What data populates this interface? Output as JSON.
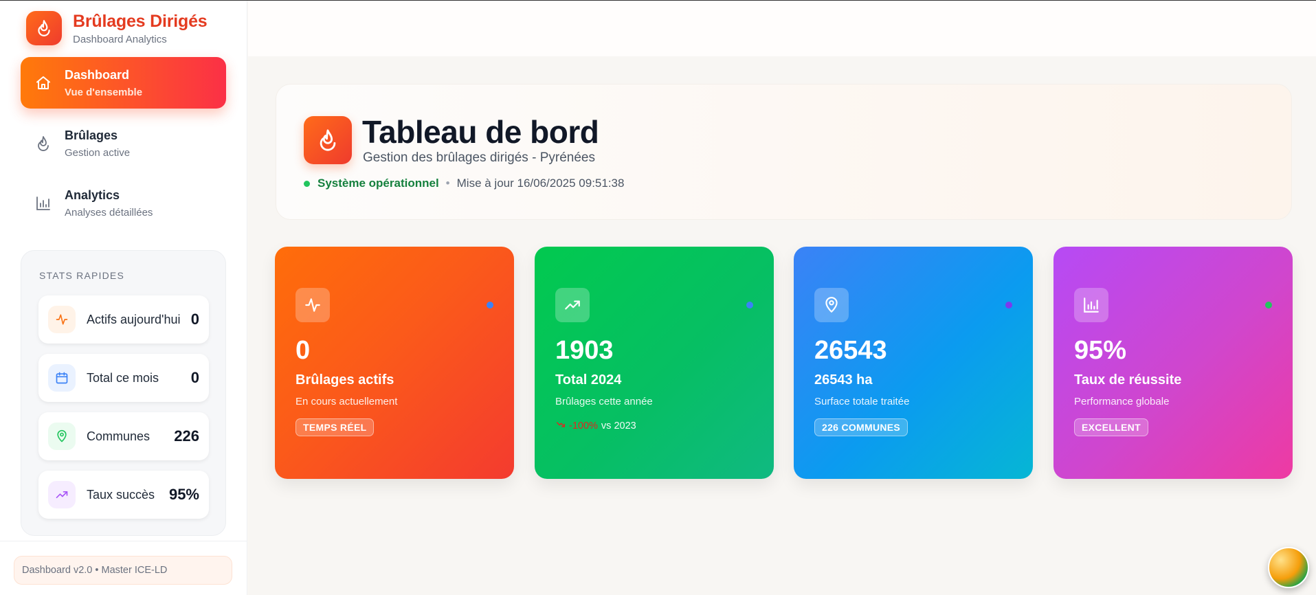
{
  "brand": {
    "title": "Brûlages Dirigés",
    "subtitle": "Dashboard Analytics",
    "logo_icon": "flame-icon"
  },
  "nav": [
    {
      "title": "Dashboard",
      "subtitle": "Vue d'ensemble",
      "icon": "home-icon",
      "active": true
    },
    {
      "title": "Brûlages",
      "subtitle": "Gestion active",
      "icon": "flame-icon",
      "active": false
    },
    {
      "title": "Analytics",
      "subtitle": "Analyses détaillées",
      "icon": "bar-chart-icon",
      "active": false
    }
  ],
  "quick_stats": {
    "heading": "STATS RAPIDES",
    "items": [
      {
        "label": "Actifs aujourd'hui",
        "value": "0",
        "icon": "activity-icon",
        "color": "#f97316"
      },
      {
        "label": "Total ce mois",
        "value": "0",
        "icon": "calendar-icon",
        "color": "#3b82f6"
      },
      {
        "label": "Communes",
        "value": "226",
        "icon": "map-pin-icon",
        "color": "#22c55e"
      },
      {
        "label": "Taux succès",
        "value": "95%",
        "icon": "trending-up-icon",
        "color": "#a855f7"
      }
    ]
  },
  "footer": {
    "text": "Dashboard v2.0 • Master ICE-LD"
  },
  "header": {
    "title": "Tableau de bord",
    "subtitle": "Gestion des brûlages dirigés - Pyrénées",
    "status": "Système opérationnel",
    "separator": "•",
    "updated": "Mise à jour 16/06/2025 09:51:38"
  },
  "kpis": [
    {
      "value": "0",
      "label": "Brûlages actifs",
      "desc": "En cours actuellement",
      "badge": "TEMPS RÉEL",
      "icon": "activity-icon",
      "dot_color": "#3b82f6"
    },
    {
      "value": "1903",
      "label": "Total 2024",
      "desc": "Brûlages cette année",
      "trend_value": "-100%",
      "trend_text": "vs 2023",
      "icon": "trending-up-icon",
      "dot_color": "#3b82f6"
    },
    {
      "value": "26543",
      "label": "26543 ha",
      "desc": "Surface totale traitée",
      "badge": "226 COMMUNES",
      "icon": "map-pin-icon",
      "dot_color": "#7c3aed"
    },
    {
      "value": "95%",
      "label": "Taux de réussite",
      "desc": "Performance globale",
      "badge": "EXCELLENT",
      "icon": "bar-chart-icon",
      "dot_color": "#22c55e"
    }
  ],
  "colors": {
    "accent": "#f97316",
    "brand_red": "#e43b20",
    "success": "#22c55e"
  }
}
